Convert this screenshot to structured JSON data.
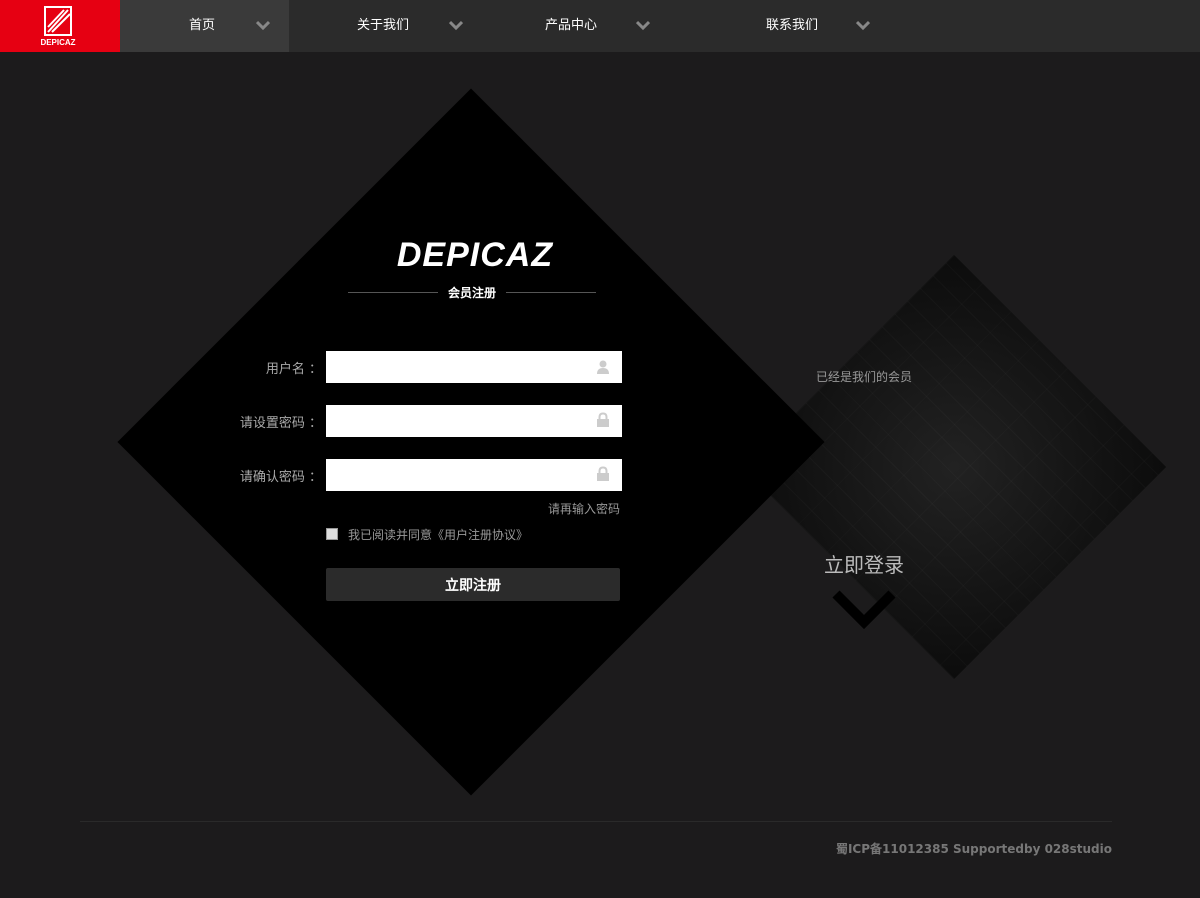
{
  "nav": {
    "logo_text": "DEPICAZ",
    "items": [
      {
        "label": "首页"
      },
      {
        "label": "关于我们"
      },
      {
        "label": "产品中心"
      },
      {
        "label": "联系我们"
      }
    ]
  },
  "form": {
    "brand": "DEPICAZ",
    "title": "会员注册",
    "username_label": "用户名 ：",
    "password_label": "请设置密码 ：",
    "confirm_label": "请确认密码 ：",
    "confirm_hint": "请再输入密码",
    "agree_text": "我已阅读并同意《用户注册协议》",
    "submit_label": "立即注册"
  },
  "login": {
    "member_text": "已经是我们的会员",
    "login_label": "立即登录"
  },
  "footer": {
    "copyright": "蜀ICP备11012385 Supportedby 028studio"
  },
  "colors": {
    "brand_red": "#e60012",
    "nav_bg": "#2b2b2b",
    "page_bg": "#1c1b1c"
  }
}
